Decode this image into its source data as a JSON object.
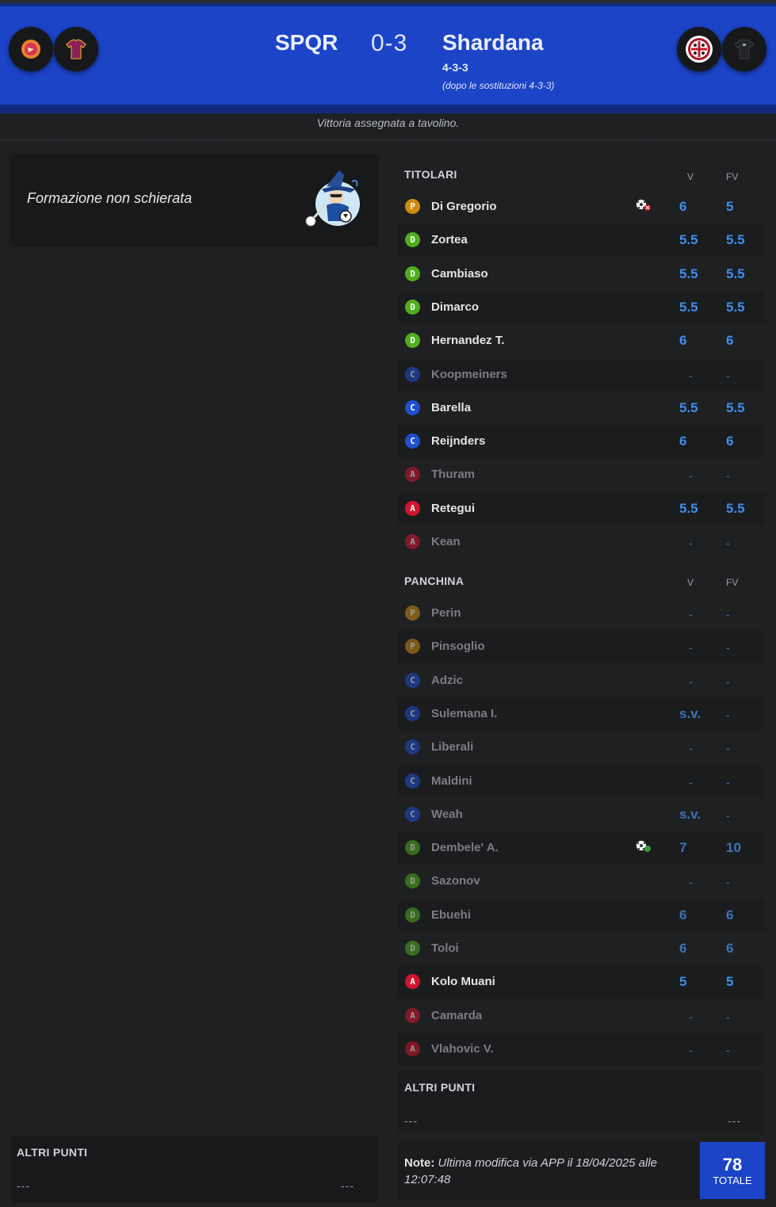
{
  "match": {
    "home_name": "SPQR",
    "score": "0-3",
    "away_name": "Shardana",
    "formation": "4-3-3",
    "formation_note": "(dopo le sostituzioni 4-3-3)",
    "verdict": "Vittoria assegnata a tavolino."
  },
  "left": {
    "message": "Formazione non schierata",
    "altri_title": "ALTRI PUNTI",
    "altri_left": "---",
    "altri_right": "---"
  },
  "titolari": {
    "title": "TITOLARI",
    "col_v": "V",
    "col_fv": "FV"
  },
  "panchina": {
    "title": "PANCHINA",
    "col_v": "V",
    "col_fv": "FV"
  },
  "role_colors": {
    "P": "#d08a12",
    "D": "#4fae1d",
    "C": "#1e4fd0",
    "A": "#d0142d"
  },
  "players_titolari": [
    {
      "role": "P",
      "name": "Di Gregorio",
      "v": "6",
      "fv": "5",
      "dim": false,
      "event": "goal-conceded"
    },
    {
      "role": "D",
      "name": "Zortea",
      "v": "5.5",
      "fv": "5.5",
      "dim": false
    },
    {
      "role": "D",
      "name": "Cambiaso",
      "v": "5.5",
      "fv": "5.5",
      "dim": false
    },
    {
      "role": "D",
      "name": "Dimarco",
      "v": "5.5",
      "fv": "5.5",
      "dim": false
    },
    {
      "role": "D",
      "name": "Hernandez T.",
      "v": "6",
      "fv": "6",
      "dim": false
    },
    {
      "role": "C",
      "name": "Koopmeiners",
      "v": "-",
      "fv": "-",
      "dim": true
    },
    {
      "role": "C",
      "name": "Barella",
      "v": "5.5",
      "fv": "5.5",
      "dim": false
    },
    {
      "role": "C",
      "name": "Reijnders",
      "v": "6",
      "fv": "6",
      "dim": false
    },
    {
      "role": "A",
      "name": "Thuram",
      "v": "-",
      "fv": "-",
      "dim": true
    },
    {
      "role": "A",
      "name": "Retegui",
      "v": "5.5",
      "fv": "5.5",
      "dim": false
    },
    {
      "role": "A",
      "name": "Kean",
      "v": "-",
      "fv": "-",
      "dim": true
    }
  ],
  "players_panchina": [
    {
      "role": "P",
      "name": "Perin",
      "v": "-",
      "fv": "-",
      "dim": true
    },
    {
      "role": "P",
      "name": "Pinsoglio",
      "v": "-",
      "fv": "-",
      "dim": true
    },
    {
      "role": "C",
      "name": "Adzic",
      "v": "-",
      "fv": "-",
      "dim": true
    },
    {
      "role": "C",
      "name": "Sulemana I.",
      "v": "s.v.",
      "fv": "-",
      "dim": true
    },
    {
      "role": "C",
      "name": "Liberali",
      "v": "-",
      "fv": "-",
      "dim": true
    },
    {
      "role": "C",
      "name": "Maldini",
      "v": "-",
      "fv": "-",
      "dim": true
    },
    {
      "role": "C",
      "name": "Weah",
      "v": "s.v.",
      "fv": "-",
      "dim": true
    },
    {
      "role": "D",
      "name": "Dembele' A.",
      "v": "7",
      "fv": "10",
      "dim": true,
      "event": "goal-scored"
    },
    {
      "role": "D",
      "name": "Sazonov",
      "v": "-",
      "fv": "-",
      "dim": true
    },
    {
      "role": "D",
      "name": "Ebuehi",
      "v": "6",
      "fv": "6",
      "dim": true
    },
    {
      "role": "D",
      "name": "Toloi",
      "v": "6",
      "fv": "6",
      "dim": true
    },
    {
      "role": "A",
      "name": "Kolo Muani",
      "v": "5",
      "fv": "5",
      "dim": false
    },
    {
      "role": "A",
      "name": "Camarda",
      "v": "-",
      "fv": "-",
      "dim": true
    },
    {
      "role": "A",
      "name": "Vlahovic V.",
      "v": "-",
      "fv": "-",
      "dim": true
    }
  ],
  "right": {
    "altri_title": "ALTRI PUNTI",
    "altri_left": "---",
    "altri_right": "---",
    "note_label": "Note:",
    "note_text": "Ultima modifica via APP il 18/04/2025 alle",
    "note_time": "12:07:48",
    "total": "78",
    "total_label": "TOTALE"
  }
}
